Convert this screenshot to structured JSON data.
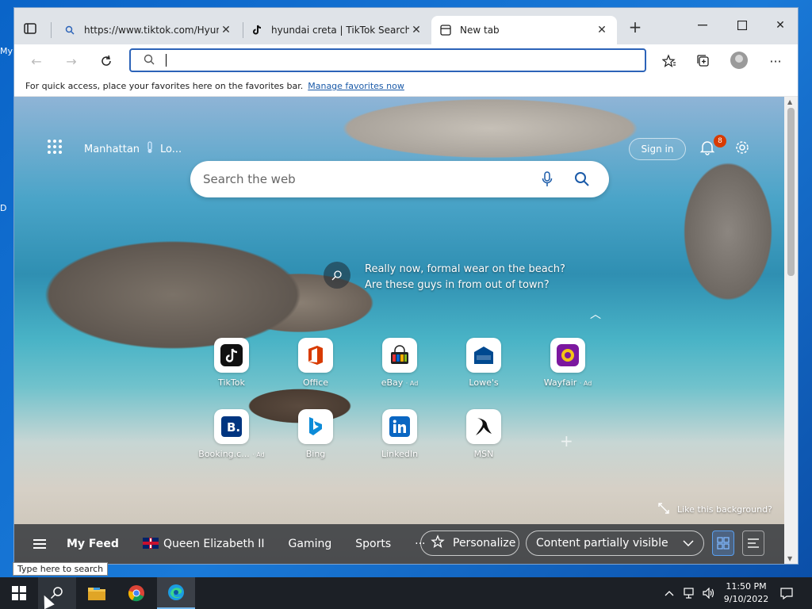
{
  "desktop": {
    "edge_labels": [
      "My",
      "D"
    ]
  },
  "browser": {
    "tabs": [
      {
        "title": "https://www.tiktok.com/Hyundai",
        "active": false
      },
      {
        "title": "hyundai creta | TikTok Search",
        "active": false
      },
      {
        "title": "New tab",
        "active": true
      }
    ],
    "address_value": "",
    "favorites_bar": {
      "text": "For quick access, place your favorites here on the favorites bar.",
      "link": "Manage favorites now"
    }
  },
  "newtab": {
    "location": "Manhattan",
    "weather_short": "Lo...",
    "sign_in": "Sign in",
    "notification_count": "8",
    "search_placeholder": "Search the web",
    "caption_line1": "Really now, formal wear on the beach?",
    "caption_line2": "Are these guys in from out of town?",
    "tiles": [
      {
        "label": "TikTok",
        "ad": ""
      },
      {
        "label": "Office",
        "ad": ""
      },
      {
        "label": "eBay",
        "ad": "· Ad"
      },
      {
        "label": "Lowe's",
        "ad": ""
      },
      {
        "label": "Wayfair",
        "ad": "· Ad"
      },
      {
        "label": "Booking.c...",
        "ad": "· Ad"
      },
      {
        "label": "Bing",
        "ad": ""
      },
      {
        "label": "LinkedIn",
        "ad": ""
      },
      {
        "label": "MSN",
        "ad": ""
      }
    ],
    "like_background": "Like this background?",
    "feed": {
      "my_feed": "My Feed",
      "items": [
        "Queen Elizabeth II",
        "Gaming",
        "Sports"
      ],
      "more": "···",
      "personalize": "Personalize",
      "content_visibility": "Content partially visible"
    }
  },
  "taskbar": {
    "time": "11:50 PM",
    "date": "9/10/2022",
    "search_tooltip": "Type here to search"
  }
}
